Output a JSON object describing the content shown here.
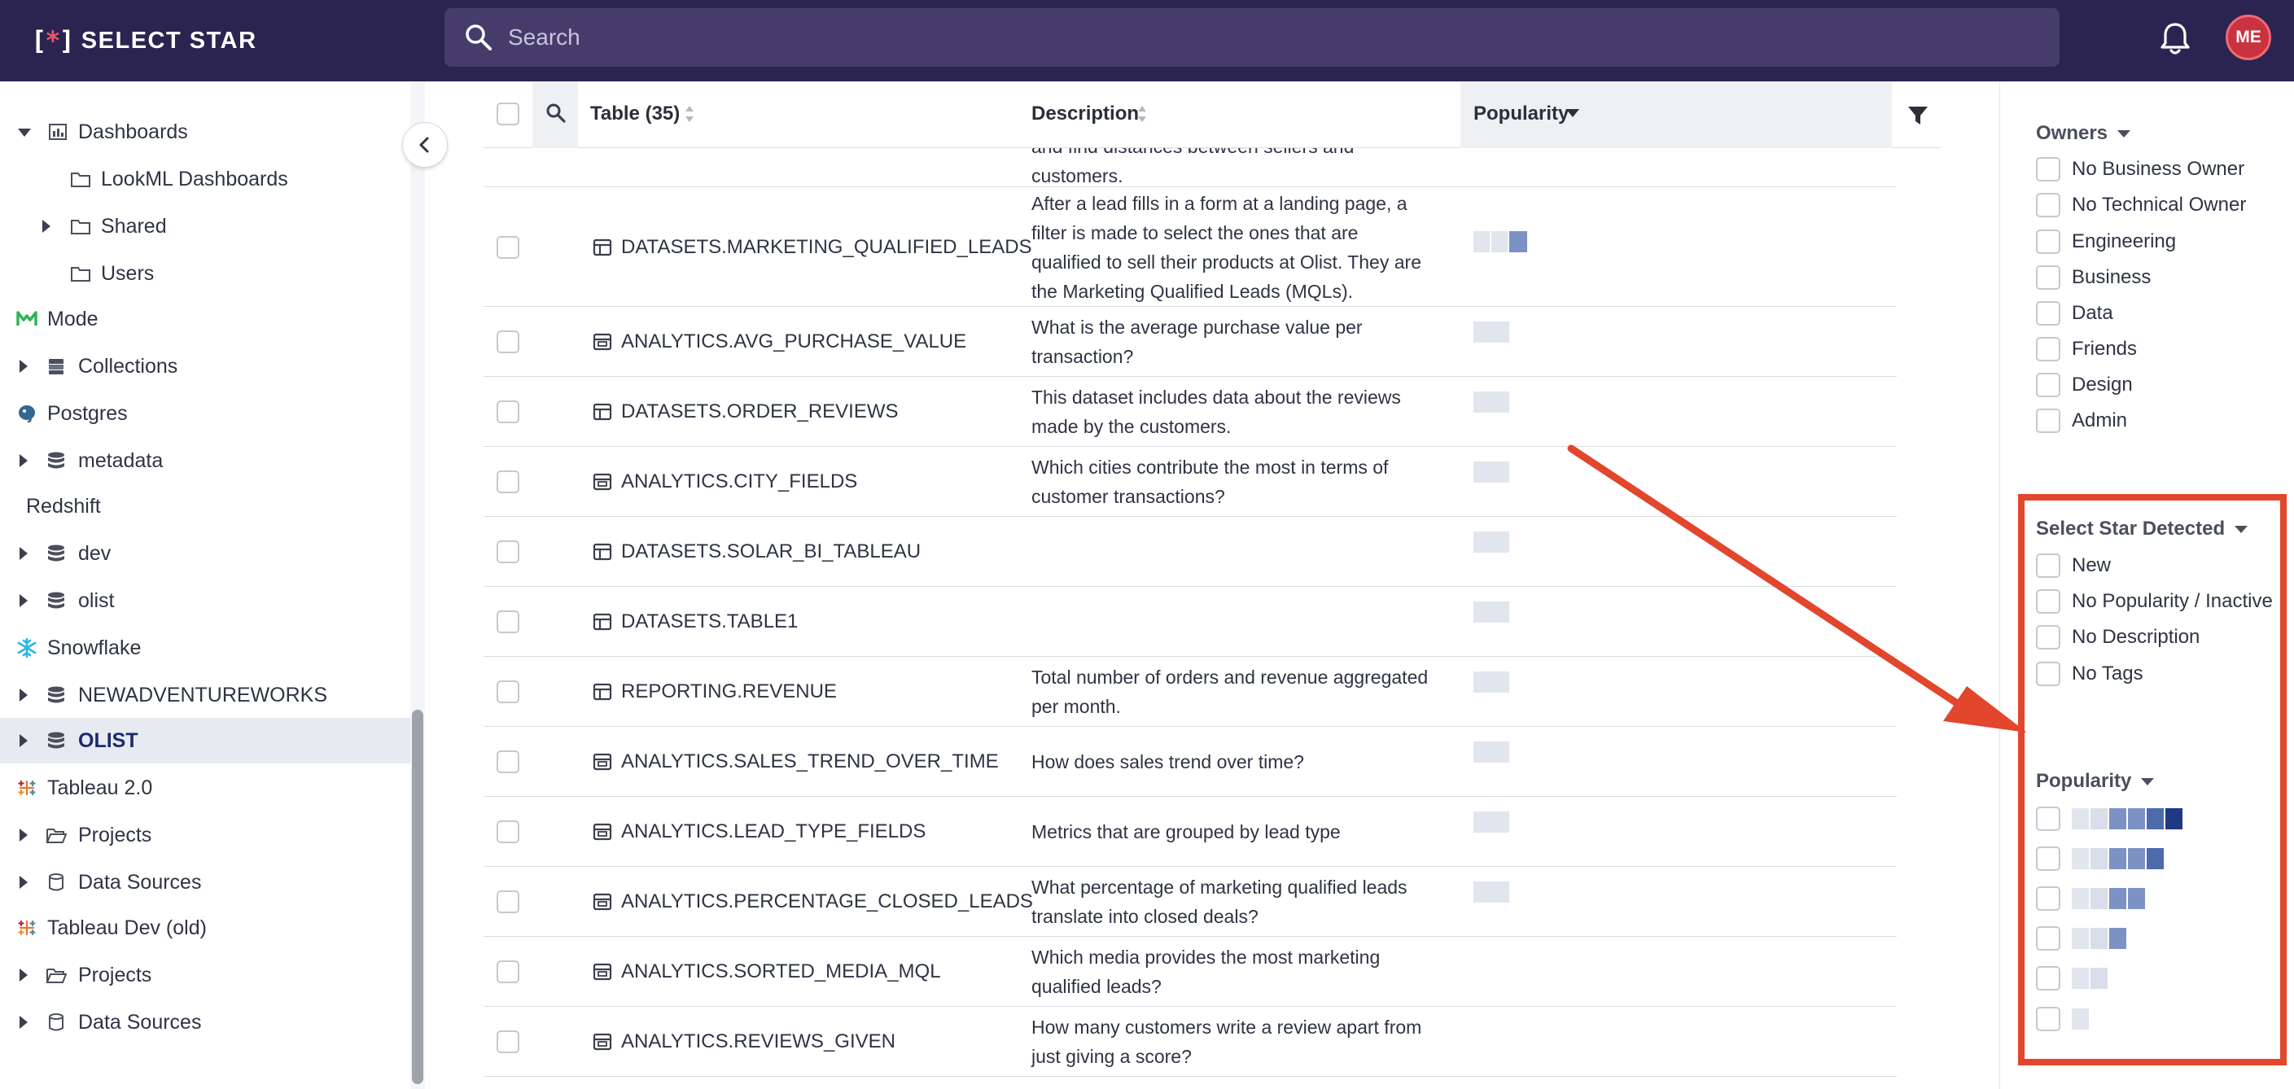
{
  "app": {
    "logo_mark_left": "[",
    "logo_mark_star": "*",
    "logo_mark_right": "]",
    "logo_text": "SELECT STAR",
    "search_placeholder": "Search",
    "user_initials": "ME"
  },
  "colors": {
    "topbar": "#2b2350",
    "accent_red": "#e2462c",
    "avatar": "#c9333f",
    "popularity_scale": [
      "#e1e5ee",
      "#d8deea",
      "#7d92c4",
      "#4d6aad",
      "#1f3a85"
    ]
  },
  "sidebar": {
    "items": [
      {
        "label": "Dashboards",
        "icon": "dashboard-icon",
        "expanded": true
      },
      {
        "label": "LookML Dashboards",
        "icon": "folder-icon"
      },
      {
        "label": "Shared",
        "icon": "folder-icon",
        "expandable": true
      },
      {
        "label": "Users",
        "icon": "folder-icon"
      },
      {
        "label": "Mode",
        "icon": "mode-logo-icon"
      },
      {
        "label": "Collections",
        "icon": "collection-icon",
        "expandable": true
      },
      {
        "label": "Postgres",
        "icon": "postgres-logo-icon"
      },
      {
        "label": "metadata",
        "icon": "database-icon",
        "expandable": true
      },
      {
        "label": "Redshift",
        "icon": "redshift-logo-icon"
      },
      {
        "label": "dev",
        "icon": "database-icon",
        "expandable": true
      },
      {
        "label": "olist",
        "icon": "database-icon",
        "expandable": true
      },
      {
        "label": "Snowflake",
        "icon": "snowflake-logo-icon"
      },
      {
        "label": "NEWADVENTUREWORKS",
        "icon": "database-icon",
        "expandable": true
      },
      {
        "label": "OLIST",
        "icon": "database-icon",
        "expandable": true,
        "selected": true
      },
      {
        "label": "Tableau 2.0",
        "icon": "tableau-logo-icon"
      },
      {
        "label": "Projects",
        "icon": "open-folder-icon",
        "expandable": true
      },
      {
        "label": "Data Sources",
        "icon": "cylinder-icon",
        "expandable": true
      },
      {
        "label": "Tableau Dev (old)",
        "icon": "tableau-logo-icon"
      },
      {
        "label": "Projects",
        "icon": "open-folder-icon",
        "expandable": true
      },
      {
        "label": "Data Sources",
        "icon": "cylinder-icon",
        "expandable": true
      }
    ]
  },
  "table": {
    "headers": {
      "table": "Table (35)",
      "description": "Description",
      "popularity": "Popularity"
    },
    "partial_row_desc": [
      "and find distances between sellers and",
      "customers."
    ],
    "rows": [
      {
        "name": "DATASETS.MARKETING_QUALIFIED_LEADS",
        "kind": "table-icon",
        "desc": [
          "After a lead fills in a form at a landing page, a",
          "filter is made to select the ones that are",
          "qualified to sell their products at Olist. They are",
          "the Marketing Qualified Leads (MQLs)."
        ],
        "popularity": 2
      },
      {
        "name": "ANALYTICS.AVG_PURCHASE_VALUE",
        "kind": "view-icon",
        "desc": [
          "What is the average purchase value per",
          "transaction?"
        ],
        "popularity": 1
      },
      {
        "name": "DATASETS.ORDER_REVIEWS",
        "kind": "table-icon",
        "desc": [
          "This dataset includes data about the reviews",
          "made by the customers."
        ],
        "popularity": 1
      },
      {
        "name": "ANALYTICS.CITY_FIELDS",
        "kind": "view-icon",
        "desc": [
          "Which cities contribute the most in terms of",
          "customer transactions?"
        ],
        "popularity": 1
      },
      {
        "name": "DATASETS.SOLAR_BI_TABLEAU",
        "kind": "table-icon",
        "desc": [],
        "popularity": 1
      },
      {
        "name": "DATASETS.TABLE1",
        "kind": "table-icon",
        "desc": [],
        "popularity": 1
      },
      {
        "name": "REPORTING.REVENUE",
        "kind": "table-icon",
        "desc": [
          "Total number of orders and revenue aggregated",
          "per month."
        ],
        "popularity": 1
      },
      {
        "name": "ANALYTICS.SALES_TREND_OVER_TIME",
        "kind": "view-icon",
        "desc": [
          "How does sales trend over time?"
        ],
        "popularity": 1
      },
      {
        "name": "ANALYTICS.LEAD_TYPE_FIELDS",
        "kind": "view-icon",
        "desc": [
          "Metrics that are grouped by lead type"
        ],
        "popularity": 1
      },
      {
        "name": "ANALYTICS.PERCENTAGE_CLOSED_LEADS",
        "kind": "view-icon",
        "desc": [
          "What percentage of marketing qualified leads",
          "translate into closed deals?"
        ],
        "popularity": 1
      },
      {
        "name": "ANALYTICS.SORTED_MEDIA_MQL",
        "kind": "view-icon",
        "desc": [
          "Which media provides the most marketing",
          "qualified leads?"
        ],
        "popularity": 0
      },
      {
        "name": "ANALYTICS.REVIEWS_GIVEN",
        "kind": "view-icon",
        "desc": [
          "How many customers write a review apart from",
          "just giving a score?"
        ],
        "popularity": 0
      }
    ]
  },
  "filters": {
    "owners": {
      "title": "Owners",
      "options": [
        "No Business Owner",
        "No Technical Owner",
        "Engineering",
        "Business",
        "Data",
        "Friends",
        "Design",
        "Admin"
      ]
    },
    "detected": {
      "title": "Select Star Detected",
      "options": [
        "New",
        "No Popularity / Inactive",
        "No Description",
        "No Tags"
      ]
    },
    "popularity": {
      "title": "Popularity",
      "levels": [
        5,
        4,
        3,
        2,
        1,
        0
      ]
    }
  }
}
